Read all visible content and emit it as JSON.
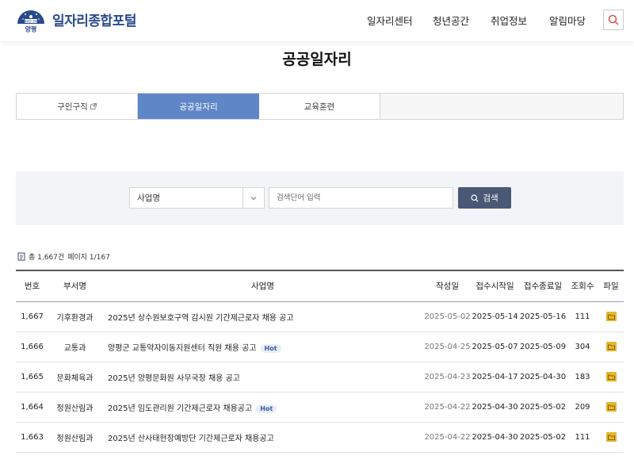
{
  "header": {
    "logo_top_text": "물맑은 양평",
    "logo_text": "양평",
    "brand": "일자리종합포털",
    "nav": [
      "일자리센터",
      "청년공간",
      "취업정보",
      "알림마당"
    ]
  },
  "page_title": "공공일자리",
  "tabs": [
    {
      "label": "구인구직",
      "active": false,
      "external": true
    },
    {
      "label": "공공일자리",
      "active": true
    },
    {
      "label": "교육훈련",
      "active": false
    }
  ],
  "search": {
    "select_value": "사업명",
    "input_placeholder": "검색단어 입력",
    "button_label": "검색"
  },
  "summary": {
    "total": "총 1,667건",
    "page": "페이지 1/167"
  },
  "table": {
    "headers": [
      "번호",
      "부서명",
      "사업명",
      "작성일",
      "접수시작일",
      "접수종료일",
      "조회수",
      "파일"
    ],
    "hot_label": "Hot",
    "rows": [
      {
        "no": "1,667",
        "dept": "기후환경과",
        "title": "2025년 상수원보호구역 감시원 기간제근로자 채용 공고",
        "hot": false,
        "written": "2025-05-02",
        "start": "2025-05-14",
        "end": "2025-05-16",
        "views": "111"
      },
      {
        "no": "1,666",
        "dept": "교통과",
        "title": "양평군 교통약자이동지원센터 직원 채용 공고",
        "hot": true,
        "written": "2025-04-25",
        "start": "2025-05-07",
        "end": "2025-05-09",
        "views": "304"
      },
      {
        "no": "1,665",
        "dept": "문화체육과",
        "title": "2025년 양평문화원 사무국장 채용 공고",
        "hot": false,
        "written": "2025-04-23",
        "start": "2025-04-17",
        "end": "2025-04-30",
        "views": "183"
      },
      {
        "no": "1,664",
        "dept": "정원산림과",
        "title": "2025년 임도관리원 기간제근로자 채용공고",
        "hot": true,
        "written": "2025-04-22",
        "start": "2025-04-30",
        "end": "2025-05-02",
        "views": "209"
      },
      {
        "no": "1,663",
        "dept": "정원산림과",
        "title": "2025년 산사태현장예방단 기간제근로자 채용공고",
        "hot": false,
        "written": "2025-04-22",
        "start": "2025-04-30",
        "end": "2025-05-02",
        "views": "111"
      }
    ]
  },
  "icons": {
    "search": "search-icon",
    "file": "folder-icon",
    "external": "external-link-icon",
    "list": "document-icon"
  },
  "colors": {
    "brand": "#2b4a8c",
    "tab_active": "#5f86c6",
    "search_button": "#4a5876",
    "search_icon": "#d9534f",
    "file_icon": "#e8b923"
  }
}
